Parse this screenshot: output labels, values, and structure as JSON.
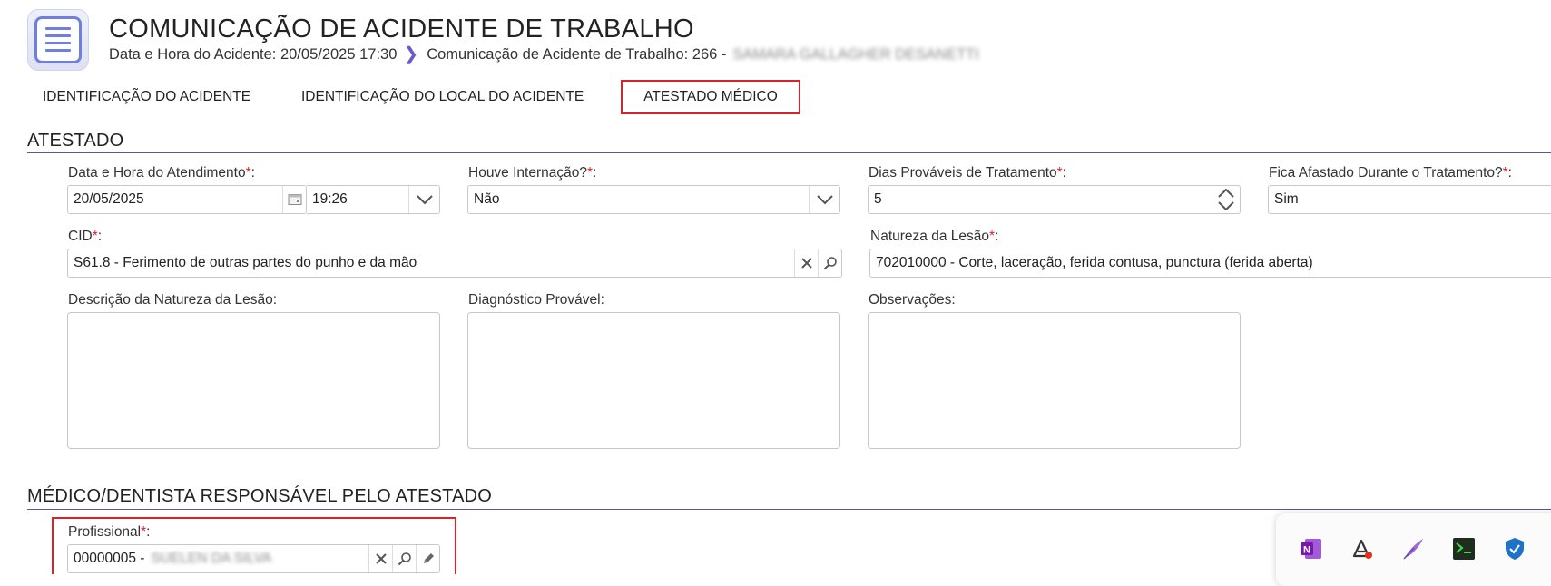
{
  "header": {
    "title": "COMUNICAÇÃO DE ACIDENTE DE TRABALHO",
    "breadcrumb": {
      "accident_datetime": "Data e Hora do Acidente: 20/05/2025 17:30",
      "communication": "Comunicação de Acidente de Trabalho: 266 -",
      "redacted_name": "SAMARA GALLAGHER DESANETTI"
    }
  },
  "tabs": [
    {
      "label": "IDENTIFICAÇÃO DO ACIDENTE"
    },
    {
      "label": "IDENTIFICAÇÃO DO LOCAL DO ACIDENTE"
    },
    {
      "label": "ATESTADO MÉDICO",
      "active": true
    }
  ],
  "atestado": {
    "section_title": "ATESTADO",
    "data_hora_atendimento": {
      "label": "Data e Hora do Atendimento",
      "date": "20/05/2025",
      "time": "19:26"
    },
    "houve_internacao": {
      "label": "Houve Internação?",
      "value": "Não"
    },
    "dias_provaveis": {
      "label": "Dias Prováveis de Tratamento",
      "value": "5"
    },
    "fica_afastado": {
      "label": "Fica Afastado Durante o Tratamento?",
      "value": "Sim"
    },
    "cid": {
      "label": "CID",
      "value": "S61.8 - Ferimento de outras partes do punho e da mão"
    },
    "natureza_lesao": {
      "label": "Natureza da Lesão",
      "value": "702010000 - Corte, laceração, ferida contusa, punctura (ferida aberta)"
    },
    "descricao_natureza": {
      "label": "Descrição da Natureza da Lesão:",
      "value": ""
    },
    "diagnostico": {
      "label": "Diagnóstico Provável:",
      "value": ""
    },
    "observacoes": {
      "label": "Observações:",
      "value": ""
    },
    "required_mark": "*",
    "colon": ":"
  },
  "medico": {
    "section_title": "MÉDICO/DENTISTA RESPONSÁVEL PELO ATESTADO",
    "profissional": {
      "label": "Profissional",
      "code": "00000005 -",
      "redacted_name": "SUELEN DA SILVA"
    }
  },
  "tray": {
    "icons": [
      "onenote-icon",
      "adobe-acrobat-icon",
      "feather-pen-icon",
      "terminal-app-icon",
      "defender-shield-icon"
    ]
  },
  "colors": {
    "accent": "#6f7fe0",
    "required": "#d9232a",
    "highlight": "#d9232a"
  }
}
